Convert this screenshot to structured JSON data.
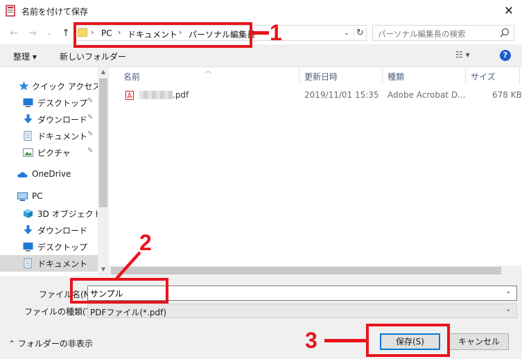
{
  "window": {
    "title": "名前を付けて保存",
    "close_symbol": "✕"
  },
  "nav": {
    "back": "←",
    "forward": "→",
    "recent": "⌄",
    "up": "↑",
    "breadcrumb": [
      "PC",
      "ドキュメント",
      "パーソナル編集長"
    ],
    "separator": "›",
    "dropdown": "⌄",
    "refresh": "↻",
    "search_placeholder": "パーソナル編集長の検索"
  },
  "toolbar": {
    "organize": "整理 ▾",
    "new_folder": "新しいフォルダー",
    "view": "☷ ▾",
    "help": "?"
  },
  "sidebar": {
    "items": [
      {
        "label": "クイック アクセス",
        "icon": "star-icon",
        "pinned": false
      },
      {
        "label": "デスクトップ",
        "icon": "desktop-icon",
        "pinned": true
      },
      {
        "label": "ダウンロード",
        "icon": "download-icon",
        "pinned": true
      },
      {
        "label": "ドキュメント",
        "icon": "document-icon",
        "pinned": true
      },
      {
        "label": "ピクチャ",
        "icon": "pictures-icon",
        "pinned": true
      },
      {
        "label": "OneDrive",
        "icon": "cloud-icon",
        "pinned": false
      },
      {
        "label": "PC",
        "icon": "pc-icon",
        "pinned": false
      },
      {
        "label": "3D オブジェクト",
        "icon": "cube-icon",
        "pinned": false
      },
      {
        "label": "ダウンロード",
        "icon": "download-icon",
        "pinned": false
      },
      {
        "label": "デスクトップ",
        "icon": "desktop-icon",
        "pinned": false
      },
      {
        "label": "ドキュメント",
        "icon": "document-icon",
        "pinned": false
      }
    ],
    "pin_symbol": "📌"
  },
  "files": {
    "columns": [
      "名前",
      "更新日時",
      "種類",
      "サイズ"
    ],
    "rows": [
      {
        "name": ".pdf",
        "modified": "2019/11/01 15:35",
        "type": "Adobe Acrobat D...",
        "size": "678 KB"
      }
    ]
  },
  "form": {
    "filename_label": "ファイル名(N):",
    "filename_value": "サンプル",
    "filetype_label": "ファイルの種類(T):",
    "filetype_value": "PDFファイル(*.pdf)",
    "hide_folders": "フォルダーの非表示",
    "save": "保存(S)",
    "cancel": "キャンセル"
  },
  "annotations": {
    "one": "1",
    "two": "2",
    "three": "3"
  },
  "colors": {
    "annotation": "#e8141b",
    "accent": "#0078d7"
  }
}
